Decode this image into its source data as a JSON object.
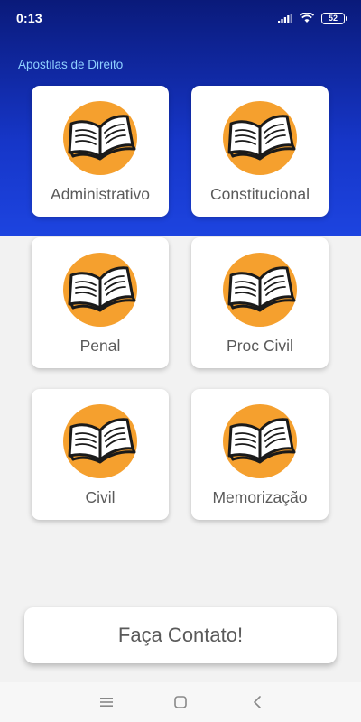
{
  "status_bar": {
    "time": "0:13",
    "battery": "52",
    "icons": [
      "signal-icon",
      "wifi-icon",
      "battery-icon"
    ]
  },
  "app": {
    "title": "Apostilas de Direito"
  },
  "categories": [
    {
      "label": "Administrativo",
      "icon": "book-icon"
    },
    {
      "label": "Constitucional",
      "icon": "book-icon"
    },
    {
      "label": "Penal",
      "icon": "book-icon"
    },
    {
      "label": "Proc Civil",
      "icon": "book-icon"
    },
    {
      "label": "Civil",
      "icon": "book-icon"
    },
    {
      "label": "Memorização",
      "icon": "book-icon"
    }
  ],
  "contact_button": {
    "label": "Faça Contato!"
  },
  "nav": {
    "icons": [
      "menu-icon",
      "home-icon",
      "back-icon"
    ]
  },
  "colors": {
    "header_top": "#0a1a7a",
    "header_bottom": "#1d44e0",
    "title": "#8fd0ff",
    "icon_orange": "#f5a02e",
    "background": "#f2f2f2"
  }
}
